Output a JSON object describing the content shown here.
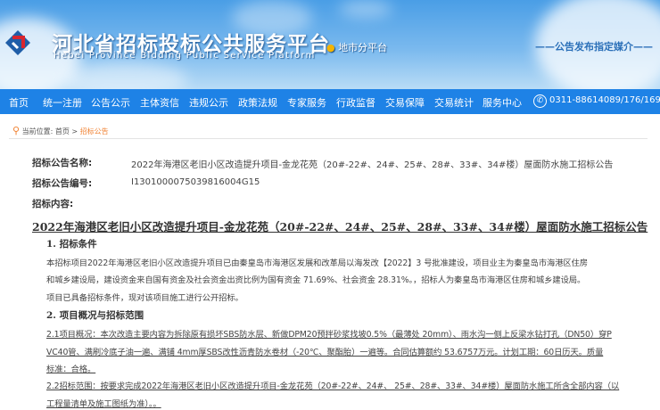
{
  "header": {
    "title": "河北省招标投标公共服务平台",
    "subtitle": "Hebei Province Bidding Public Service Platform",
    "city_platform": "地市分平台",
    "slogan": "——公告发布指定媒介——"
  },
  "nav": {
    "items": [
      "首页",
      "统一注册",
      "公告公示",
      "主体资信",
      "违规公示",
      "政策法规",
      "专家服务",
      "行政监督",
      "交易保障",
      "交易统计",
      "服务中心"
    ],
    "phone": "0311-88614089/176/169"
  },
  "breadcrumb": {
    "prefix": "当前位置:",
    "home": "首页",
    "sep": ">",
    "current": "招标公告"
  },
  "notice": {
    "name_label": "招标公告名称:",
    "name_value": "2022年海港区老旧小区改造提升项目-金龙花苑（20#-22#、24#、25#、28#、33#、34#楼）屋面防水施工招标公告",
    "code_label": "招标公告编号:",
    "code_value": "I1301000075039816004G15",
    "content_label": "招标内容:"
  },
  "doc": {
    "title": "2022年海港区老旧小区改造提升项目-金龙花苑（20#-22#、24#、25#、28#、33#、34#楼）屋面防水施工招标公告",
    "section1": "1.  招标条件",
    "s1_lines": [
      "本招标项目2022年海港区老旧小区改造提升项目已由秦皇岛市海港区发展和改革局以海发改【2022】3 号批准建设，项目业主为秦皇岛市海港区住房",
      "和城乡建设局，建设资金来自国有资金及社会资金出资比例为国有资金 71.69%、社会资金 28.31%。，招标人为秦皇岛市海港区住房和城乡建设局。",
      "项目已具备招标条件，现对该项目施工进行公开招标。"
    ],
    "section2": "2.  项目概况与招标范围",
    "s2_lines": [
      "2.1项目概况：本次改造主要内容为拆除原有损坏SBS防水层、新做DPM20预拌砂浆找坡0.5%（最薄处 20mm）、雨水沟一侧上反梁水钻打孔（DN50）穿P",
      "VC40管、满刷冷底子油一遍、满铺 4mm厚SBS改性沥青防水卷材（-20℃、聚酯胎）一遍等。合同估算额约 53.6757万元。计划工期：60日历天。质量",
      "标准：合格。",
      "2.2招标范围：按要求完成2022年海港区老旧小区改造提升项目-金龙花苑（20#-22#、24#、 25#、28#、33#、34#楼）屋面防水施工所含全部内容（以",
      "工程量清单及施工图纸为准）。。"
    ]
  },
  "colors": {
    "nav": "#1e82e6",
    "accent": "#f08030"
  }
}
